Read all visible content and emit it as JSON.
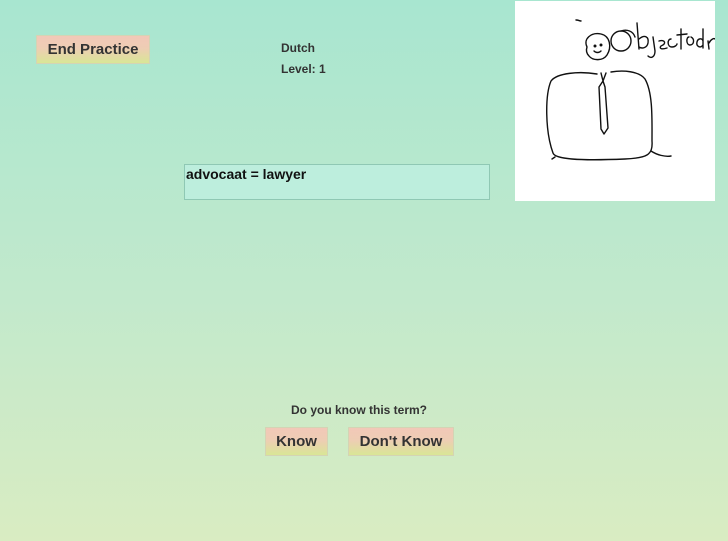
{
  "practice": {
    "end_label": "End Practice",
    "language": "Dutch",
    "level": "Level: 1",
    "term": "advocaat = lawyer",
    "question": "Do you know this term?",
    "know_label": "Know",
    "dont_know_label": "Don't Know"
  },
  "sketch": {
    "caption": "Objector"
  },
  "colors": {
    "background_top": "#a8e6d0",
    "background_bottom": "#d9ecc2",
    "button_top": "#f2c8b8",
    "button_bottom": "#d9e696",
    "term_box": "#bdeedd"
  }
}
